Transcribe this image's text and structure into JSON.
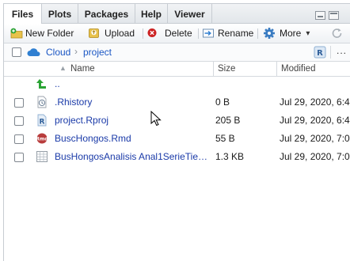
{
  "tabs": [
    {
      "label": "Files",
      "active": true
    },
    {
      "label": "Plots",
      "active": false
    },
    {
      "label": "Packages",
      "active": false
    },
    {
      "label": "Help",
      "active": false
    },
    {
      "label": "Viewer",
      "active": false
    }
  ],
  "toolbar": {
    "new_folder": "New Folder",
    "upload": "Upload",
    "delete": "Delete",
    "rename": "Rename",
    "more": "More",
    "more_caret": "▾",
    "overflow": "..."
  },
  "breadcrumb": {
    "root": "Cloud",
    "separator": "›",
    "current": "project"
  },
  "columns": {
    "name": "Name",
    "size": "Size",
    "modified": "Modified"
  },
  "up_label": "..",
  "files": [
    {
      "name": ".Rhistory",
      "size": "0 B",
      "modified": "Jul 29, 2020, 6:4",
      "icon": "rhistory-icon"
    },
    {
      "name": "project.Rproj",
      "size": "205 B",
      "modified": "Jul 29, 2020, 6:4",
      "icon": "rproj-icon"
    },
    {
      "name": "BuscHongos.Rmd",
      "size": "55 B",
      "modified": "Jul 29, 2020, 7:0",
      "icon": "rmd-icon"
    },
    {
      "name": "BusHongosAnalisis Anal1SerieTie…",
      "size": "1.3 KB",
      "modified": "Jul 29, 2020, 7:0",
      "icon": "csv-table-icon"
    }
  ],
  "colors": {
    "link": "#1a3aa8",
    "crumb": "#1a56c4",
    "green_arrow": "#2aa334",
    "delete_red": "#cc2222",
    "cloud_blue": "#2f7fd1"
  }
}
